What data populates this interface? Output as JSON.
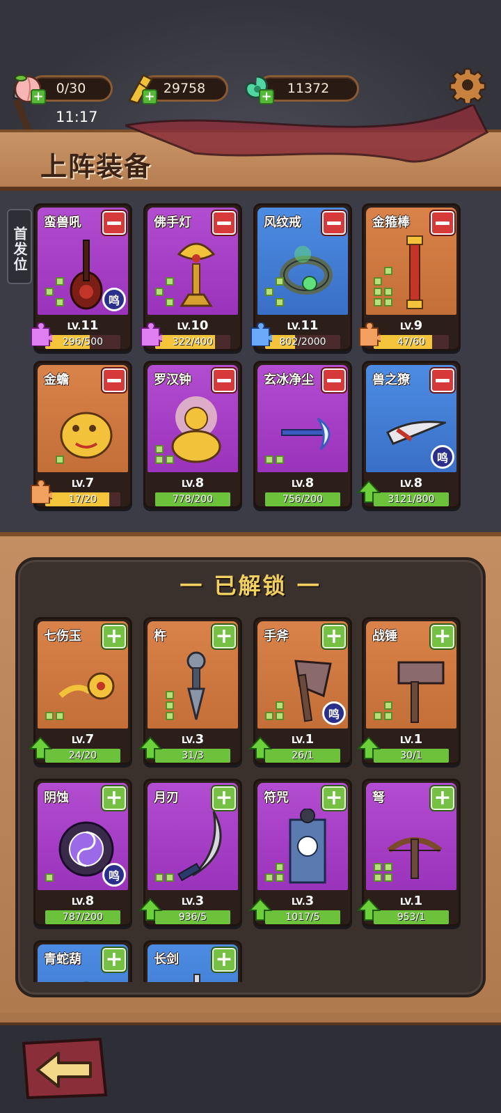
{
  "topbar": {
    "resources": [
      {
        "icon": "peach-icon",
        "value": "0/30"
      },
      {
        "icon": "ticket-icon",
        "value": "29758"
      },
      {
        "icon": "jade-icon",
        "value": "11372"
      }
    ],
    "time": "11:17"
  },
  "banner": {
    "title": "上阵装备"
  },
  "first_position": {
    "label": "首发位"
  },
  "equipped": [
    {
      "name": "蛮兽吼",
      "rarity": "purple",
      "icon": "pipa-icon",
      "level": "11",
      "progress": "296/500",
      "ratio": 0.59,
      "bar": "y",
      "pips": [
        0,
        1,
        1,
        0,
        0,
        1
      ],
      "sound": "鸣",
      "corner": "puzzle-purple"
    },
    {
      "name": "佛手灯",
      "rarity": "purple",
      "icon": "lotus-lamp-icon",
      "level": "10",
      "progress": "322/400",
      "ratio": 0.8,
      "bar": "y",
      "pips": [
        0,
        1,
        1,
        0,
        0,
        1
      ],
      "corner": "puzzle-purple"
    },
    {
      "name": "风纹戒",
      "rarity": "blue",
      "icon": "ring-icon",
      "level": "11",
      "progress": "802/2000",
      "ratio": 0.4,
      "bar": "y",
      "pips": [
        0,
        1,
        1,
        0,
        0,
        1
      ],
      "corner": "puzzle-blue"
    },
    {
      "name": "金箍棒",
      "rarity": "orange",
      "icon": "golden-staff-icon",
      "level": "9",
      "progress": "47/60",
      "ratio": 0.78,
      "bar": "y",
      "pips": [
        0,
        1,
        1,
        0,
        1,
        1,
        1,
        1
      ],
      "corner": "puzzle-orange"
    },
    {
      "name": "金蟾",
      "rarity": "orange",
      "icon": "golden-toad-icon",
      "level": "7",
      "progress": "17/20",
      "ratio": 0.85,
      "bar": "y",
      "pips": [
        0,
        1
      ],
      "corner": "puzzle-orange"
    },
    {
      "name": "罗汉钟",
      "rarity": "purple",
      "icon": "arhat-icon",
      "level": "8",
      "progress": "778/200",
      "ratio": 1,
      "bar": "g",
      "pips": [
        1,
        0,
        1,
        1
      ]
    },
    {
      "name": "玄冰净尘",
      "rarity": "purple",
      "icon": "ice-axe-icon",
      "level": "8",
      "progress": "756/200",
      "ratio": 1,
      "bar": "g",
      "pips": [
        1,
        1
      ]
    },
    {
      "name": "兽之獠",
      "rarity": "blue",
      "icon": "fang-blade-icon",
      "level": "8",
      "progress": "3121/800",
      "ratio": 1,
      "bar": "g",
      "pips": [],
      "sound": "鸣",
      "corner": "upgrade-arrow"
    }
  ],
  "unlocked": {
    "title": "一 已解锁 一",
    "items": [
      {
        "name": "七伤玉",
        "rarity": "orange",
        "icon": "jade-pendant-icon",
        "level": "7",
        "progress": "24/20",
        "ratio": 1,
        "bar": "g",
        "pips": [
          0,
          0,
          1,
          1
        ],
        "corner": "upgrade-arrow"
      },
      {
        "name": "杵",
        "rarity": "orange",
        "icon": "vajra-icon",
        "level": "3",
        "progress": "31/3",
        "ratio": 1,
        "bar": "g",
        "pips": [
          0,
          1,
          0,
          1,
          0,
          1
        ],
        "corner": "upgrade-arrow"
      },
      {
        "name": "手斧",
        "rarity": "orange",
        "icon": "hand-axe-icon",
        "level": "1",
        "progress": "26/1",
        "ratio": 1,
        "bar": "g",
        "pips": [
          0,
          1,
          1,
          1
        ],
        "sound": "鸣",
        "corner": "upgrade-arrow"
      },
      {
        "name": "战锤",
        "rarity": "orange",
        "icon": "war-hammer-icon",
        "level": "1",
        "progress": "30/1",
        "ratio": 1,
        "bar": "g",
        "pips": [
          0,
          1,
          1,
          1
        ],
        "corner": "upgrade-arrow"
      },
      {
        "name": "阴蚀",
        "rarity": "purple",
        "icon": "yin-orb-icon",
        "level": "8",
        "progress": "787/200",
        "ratio": 1,
        "bar": "g",
        "pips": [
          1,
          0
        ],
        "sound": "鸣"
      },
      {
        "name": "月刃",
        "rarity": "purple",
        "icon": "moon-blade-icon",
        "level": "3",
        "progress": "936/5",
        "ratio": 1,
        "bar": "g",
        "pips": [
          1,
          1
        ],
        "corner": "upgrade-arrow"
      },
      {
        "name": "符咒",
        "rarity": "purple",
        "icon": "talisman-icon",
        "level": "3",
        "progress": "1017/5",
        "ratio": 1,
        "bar": "g",
        "pips": [
          0,
          1,
          1,
          1
        ],
        "corner": "upgrade-arrow"
      },
      {
        "name": "弩",
        "rarity": "purple",
        "icon": "crossbow-icon",
        "level": "1",
        "progress": "953/1",
        "ratio": 1,
        "bar": "g",
        "pips": [
          1,
          1,
          1,
          1
        ],
        "corner": "upgrade-arrow"
      },
      {
        "name": "青蛇葫",
        "rarity": "blue",
        "icon": "gourd-icon"
      },
      {
        "name": "长剑",
        "rarity": "blue",
        "icon": "long-sword-icon"
      }
    ]
  },
  "level_prefix": "LV.",
  "sound_label": "鸣",
  "colors": {
    "purple": "#b24cd0",
    "blue": "#4c8ce2",
    "orange": "#d9834a",
    "minus": "#d6393a",
    "plus": "#76c046"
  }
}
